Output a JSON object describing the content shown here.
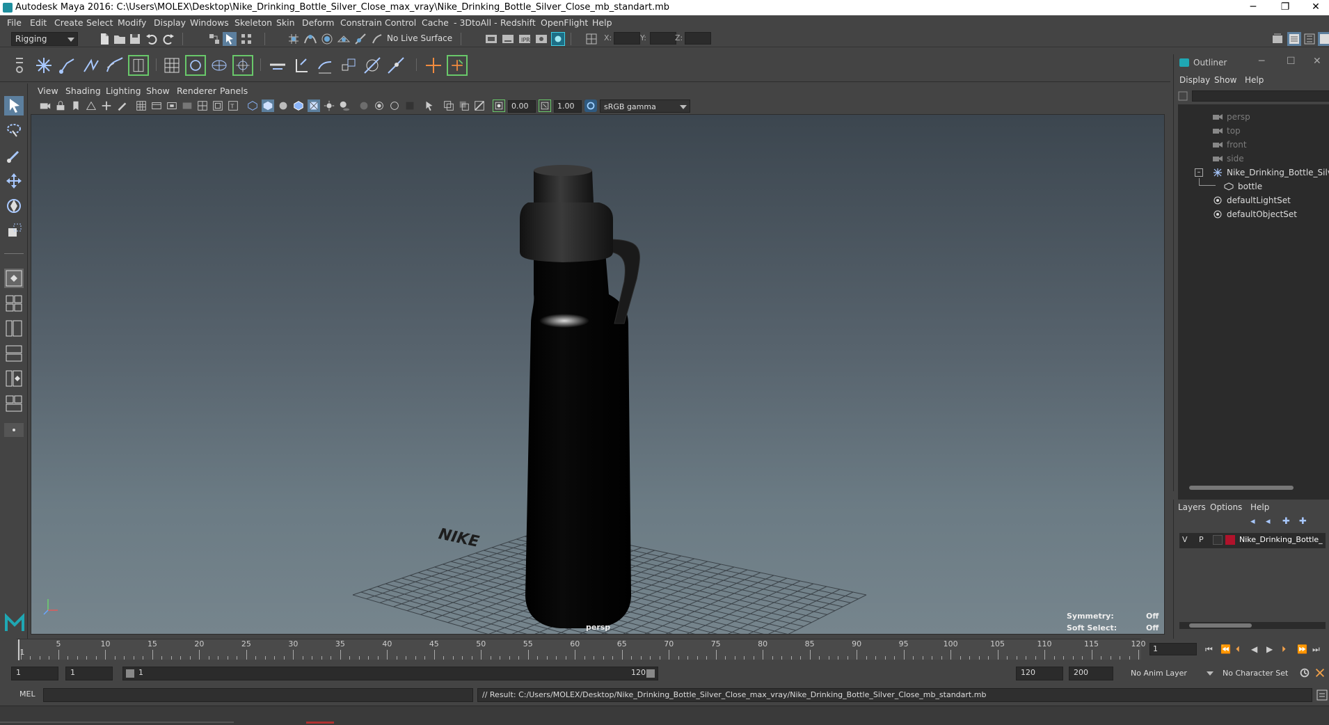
{
  "window": {
    "title": "Autodesk Maya 2016: C:\\Users\\MOLEX\\Desktop\\Nike_Drinking_Bottle_Silver_Close_max_vray\\Nike_Drinking_Bottle_Silver_Close_mb_standart.mb",
    "minimize": "─",
    "restore": "❐",
    "close": "✕"
  },
  "menu": [
    "File",
    "Edit",
    "Create",
    "Select",
    "Modify",
    "Display",
    "Windows",
    "Skeleton",
    "Skin",
    "Deform",
    "Constrain",
    "Control",
    "Cache",
    "- 3DtoAll -",
    "Redshift",
    "OpenFlight",
    "Help"
  ],
  "statusline": {
    "mode": "Rigging",
    "live_surface": "No Live Surface",
    "x_label": "X:",
    "y_label": "Y:",
    "z_label": "Z:"
  },
  "viewport": {
    "menu": [
      "View",
      "Shading",
      "Lighting",
      "Show",
      "Renderer",
      "Panels"
    ],
    "exposure": "0.00",
    "gamma": "1.00",
    "colorspace": "sRGB gamma",
    "camera_label": "persp",
    "symmetry_label": "Symmetry:",
    "symmetry_value": "Off",
    "soft_select_label": "Soft Select:",
    "soft_select_value": "Off",
    "brand_text": "NIKE"
  },
  "outliner": {
    "title": "Outliner",
    "menu": [
      "Display",
      "Show",
      "Help"
    ],
    "items": [
      "persp",
      "top",
      "front",
      "side",
      "Nike_Drinking_Bottle_Silver_Cl",
      "bottle",
      "defaultLightSet",
      "defaultObjectSet"
    ]
  },
  "layers": {
    "menu": [
      "Layers",
      "Options",
      "Help"
    ],
    "v": "V",
    "p": "P",
    "layer_name": "Nike_Drinking_Bottle_",
    "layer_color": "#b0122b"
  },
  "timeline": {
    "ticks": [
      "1",
      "5",
      "10",
      "15",
      "20",
      "25",
      "30",
      "35",
      "40",
      "45",
      "50",
      "55",
      "60",
      "65",
      "70",
      "75",
      "80",
      "85",
      "90",
      "95",
      "100",
      "105",
      "110",
      "115",
      "120"
    ],
    "current_frame": "1"
  },
  "range": {
    "start": "1",
    "start2": "1",
    "slider_start": "1",
    "slider_end": "120",
    "end": "120",
    "end2": "200",
    "anim_layer": "No Anim Layer",
    "character_set": "No Character Set"
  },
  "cmd": {
    "lang": "MEL",
    "result": "// Result: C:/Users/MOLEX/Desktop/Nike_Drinking_Bottle_Silver_Close_max_vray/Nike_Drinking_Bottle_Silver_Close_mb_standart.mb"
  }
}
